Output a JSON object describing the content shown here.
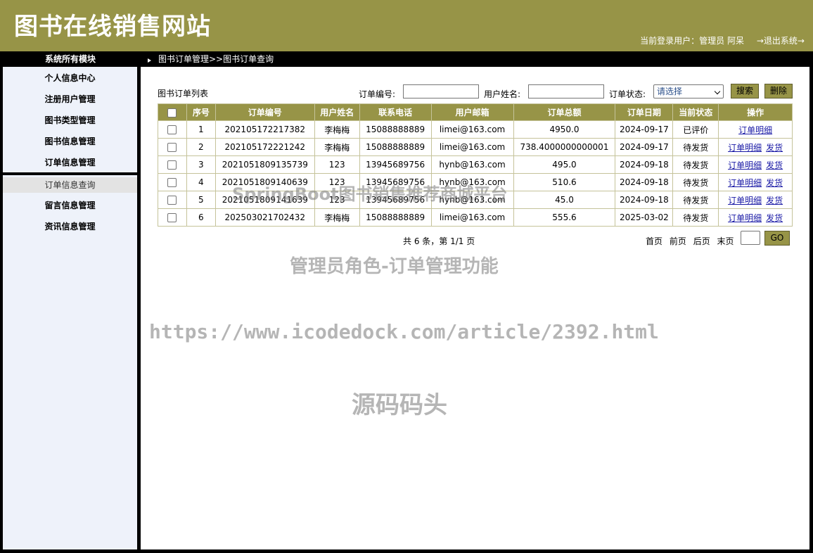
{
  "header": {
    "site_title": "图书在线销售网站",
    "user_info": "当前登录用户：管理员 阿呆",
    "logout": "→退出系统→"
  },
  "topbar": {
    "menu_title": "系统所有模块",
    "breadcrumb": "图书订单管理>>图书订单查询"
  },
  "sidebar": {
    "items": [
      "个人信息中心",
      "注册用户管理",
      "图书类型管理",
      "图书信息管理",
      "订单信息管理"
    ],
    "active_sub": "订单信息查询",
    "items_after": [
      "留言信息管理",
      "资讯信息管理"
    ]
  },
  "main": {
    "list_title": "图书订单列表",
    "search": {
      "order_no_label": "订单编号:",
      "username_label": "用户姓名:",
      "status_label": "订单状态:",
      "status_value": "请选择",
      "search_btn": "搜索",
      "delete_btn": "删除"
    },
    "columns": [
      "",
      "序号",
      "订单编号",
      "用户姓名",
      "联系电话",
      "用户邮箱",
      "订单总额",
      "订单日期",
      "当前状态",
      "操作"
    ],
    "rows": [
      {
        "no": "1",
        "order_no": "202105172217382",
        "name": "李梅梅",
        "phone": "15088888889",
        "email": "limei@163.com",
        "total": "4950.0",
        "date": "2024-09-17",
        "status": "已评价",
        "actions": [
          "订单明细"
        ]
      },
      {
        "no": "2",
        "order_no": "202105172221242",
        "name": "李梅梅",
        "phone": "15088888889",
        "email": "limei@163.com",
        "total": "738.4000000000001",
        "date": "2024-09-17",
        "status": "待发货",
        "actions": [
          "订单明细",
          "发货"
        ]
      },
      {
        "no": "3",
        "order_no": "2021051809135739",
        "name": "123",
        "phone": "13945689756",
        "email": "hynb@163.com",
        "total": "495.0",
        "date": "2024-09-18",
        "status": "待发货",
        "actions": [
          "订单明细",
          "发货"
        ]
      },
      {
        "no": "4",
        "order_no": "2021051809140639",
        "name": "123",
        "phone": "13945689756",
        "email": "hynb@163.com",
        "total": "510.6",
        "date": "2024-09-18",
        "status": "待发货",
        "actions": [
          "订单明细",
          "发货"
        ]
      },
      {
        "no": "5",
        "order_no": "2021051809141639",
        "name": "123",
        "phone": "13945689756",
        "email": "hynb@163.com",
        "total": "45.0",
        "date": "2024-09-18",
        "status": "待发货",
        "actions": [
          "订单明细",
          "发货"
        ]
      },
      {
        "no": "6",
        "order_no": "202503021702432",
        "name": "李梅梅",
        "phone": "15088888889",
        "email": "limei@163.com",
        "total": "555.6",
        "date": "2025-03-02",
        "status": "待发货",
        "actions": [
          "订单明细",
          "发货"
        ]
      }
    ],
    "pager": {
      "info": "共 6 条，第 1/1 页",
      "first": "首页",
      "prev": "前页",
      "next": "后页",
      "last": "末页",
      "go": "GO"
    }
  },
  "watermarks": {
    "line1": "SpringBoot图书销售推荐商城平台",
    "line2": "管理员角色-订单管理功能",
    "line3": "https://www.icodedock.com/article/2392.html",
    "line4": "源码码头"
  },
  "colors": {
    "accent": "#979447",
    "sidebar_bg": "#eef2fa",
    "link": "#1a1aa6"
  }
}
